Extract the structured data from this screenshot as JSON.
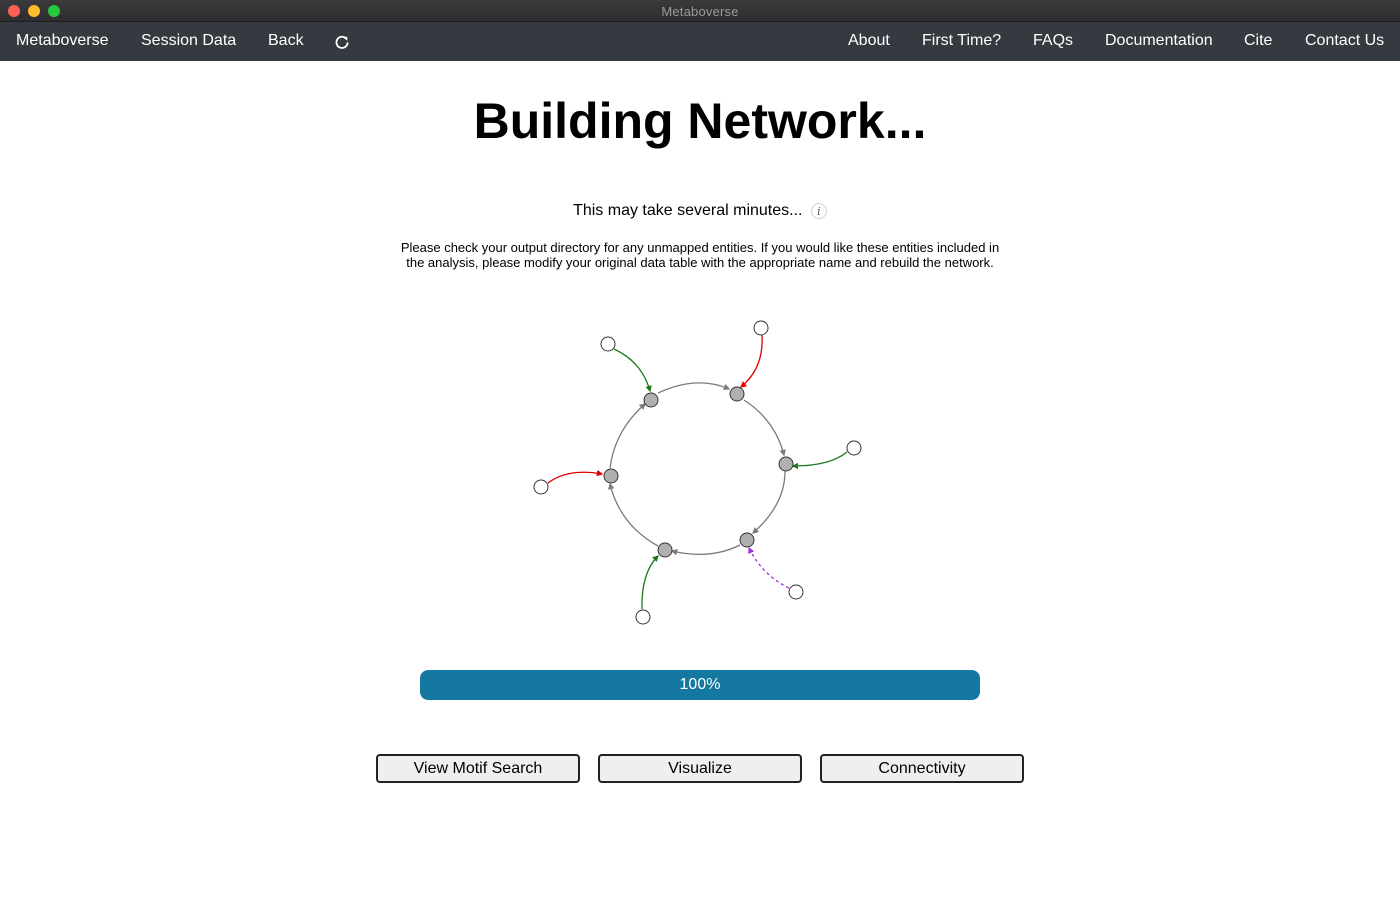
{
  "window": {
    "title": "Metaboverse"
  },
  "nav": {
    "left": [
      "Metaboverse",
      "Session Data",
      "Back"
    ],
    "refresh_icon": "refresh-icon",
    "right": [
      "About",
      "First Time?",
      "FAQs",
      "Documentation",
      "Cite",
      "Contact Us"
    ]
  },
  "main": {
    "title": "Building Network...",
    "subtitle": "This may take several minutes...",
    "info_icon_label": "i",
    "note": "Please check your output directory for any unmapped entities. If you would like these entities included in the analysis, please modify your original data table with the appropriate name and rebuild the network.",
    "progress": {
      "value": 100,
      "label": "100%",
      "color": "#1478a0"
    },
    "buttons": [
      "View Motif Search",
      "Visualize",
      "Connectivity"
    ]
  },
  "colors": {
    "navbar": "#343a40",
    "edge_green": "#1a7a1a",
    "edge_red": "#e00000",
    "edge_purple": "#9b30d9",
    "node_fill": "#b0b0b0"
  }
}
